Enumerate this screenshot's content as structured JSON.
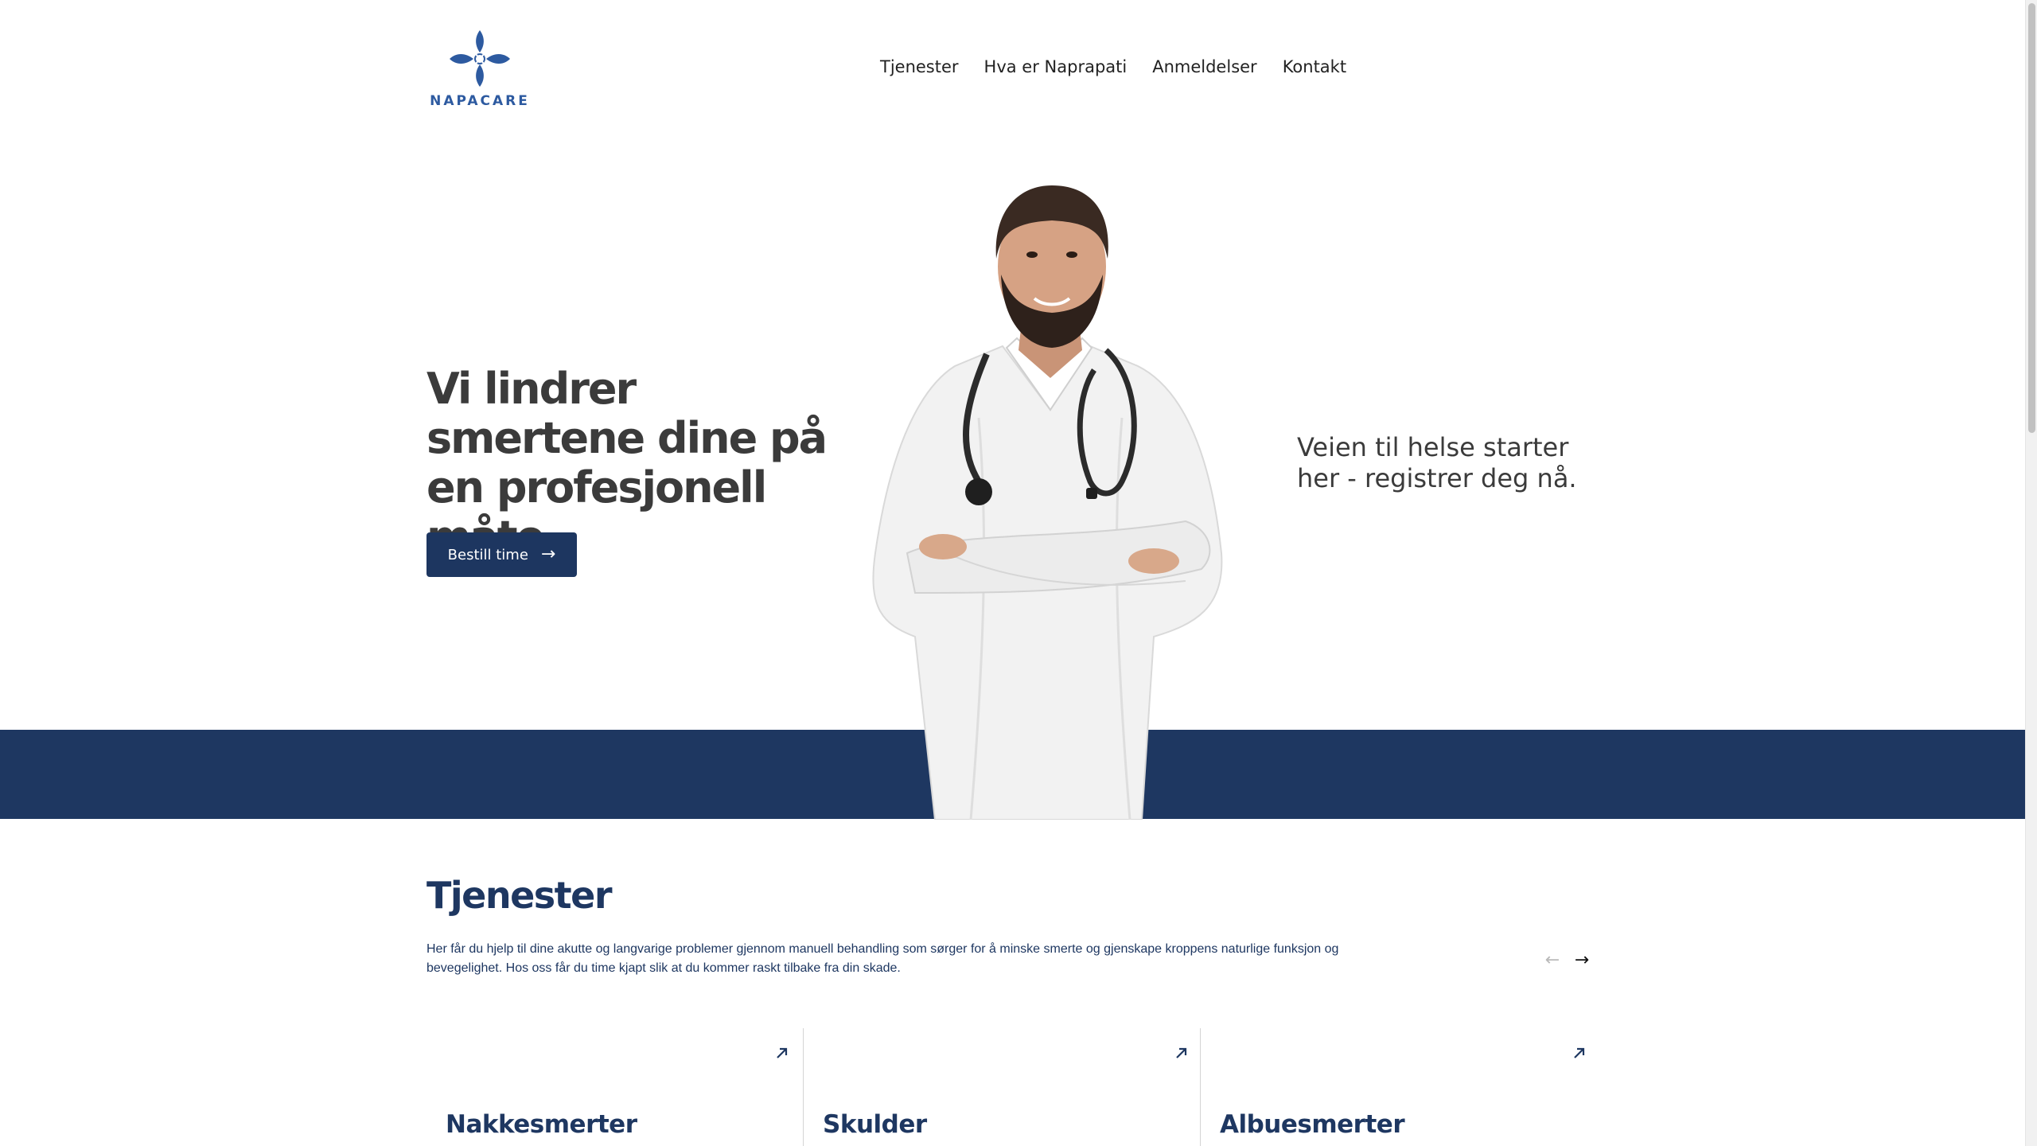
{
  "brand": {
    "name": "NAPACARE",
    "color": "#2d5aa0"
  },
  "nav": {
    "items": [
      {
        "label": "Tjenester"
      },
      {
        "label": "Hva er Naprapati"
      },
      {
        "label": "Anmeldelser"
      },
      {
        "label": "Kontakt"
      }
    ]
  },
  "hero": {
    "title": "Vi lindrer smertene dine på en profesjonell måte",
    "cta_label": "Bestill time",
    "tagline": "Veien til helse starter her - registrer deg nå."
  },
  "services": {
    "title": "Tjenester",
    "description": "Her får du hjelp til dine akutte og langvarige problemer gjennom manuell behandling som sørger for å minske smerte og gjenskape kroppens naturlige funksjon og bevegelighet. Hos oss får du time kjapt slik at du kommer raskt tilbake fra din skade.",
    "cards": [
      {
        "title": "Nakkesmerter"
      },
      {
        "title": "Skulder"
      },
      {
        "title": "Albuesmerter"
      }
    ]
  },
  "colors": {
    "navy": "#1e3761",
    "text_dark": "#3b3b3b",
    "background": "#ffffff"
  }
}
